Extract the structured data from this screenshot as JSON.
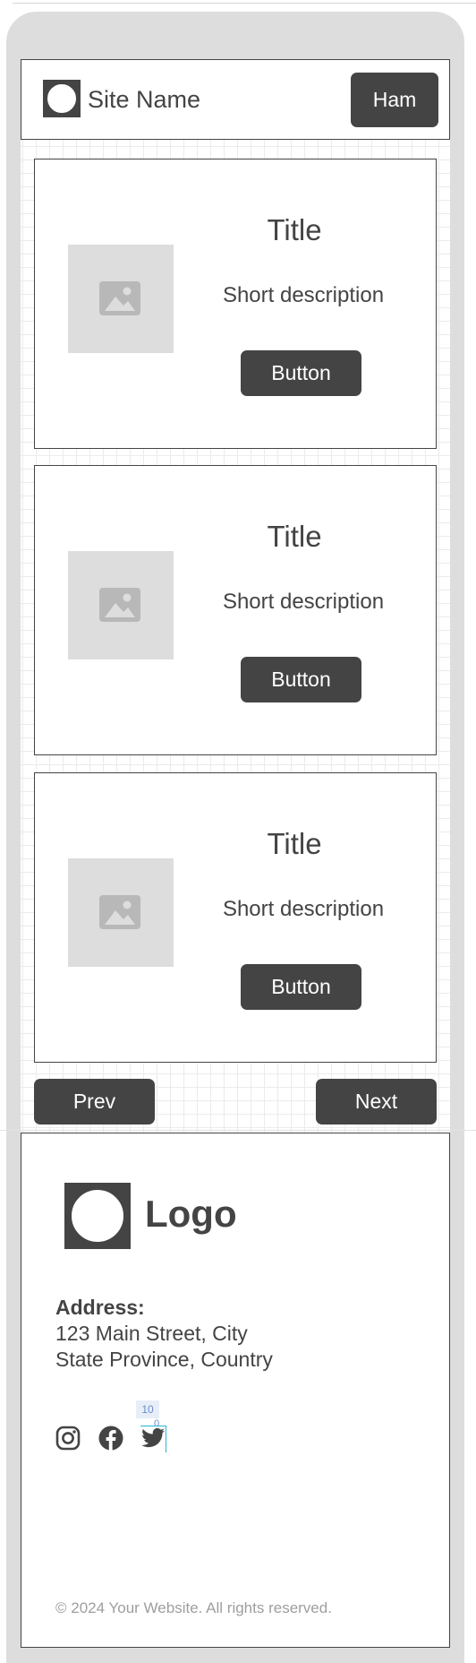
{
  "header": {
    "site_name": "Site Name",
    "menu_button": "Ham"
  },
  "cards": [
    {
      "title": "Title",
      "description": "Short description",
      "button": "Button"
    },
    {
      "title": "Title",
      "description": "Short description",
      "button": "Button"
    },
    {
      "title": "Title",
      "description": "Short description",
      "button": "Button"
    }
  ],
  "pagination": {
    "prev": "Prev",
    "next": "Next"
  },
  "footer": {
    "logo_text": "Logo",
    "address_label": "Address:",
    "address_lines": [
      "123 Main Street, City",
      "State Province, Country"
    ],
    "social_icons": [
      "instagram-icon",
      "facebook-icon",
      "twitter-icon"
    ],
    "spacing_marker": {
      "value": "10",
      "offset": "0"
    },
    "copyright": "© 2024 Your Website. All rights reserved."
  },
  "colors": {
    "dark": "#444444",
    "placeholder": "#dddddd",
    "frame": "#dddddd",
    "muted_text": "#9e9e9e",
    "marker": "#29b6d6"
  }
}
